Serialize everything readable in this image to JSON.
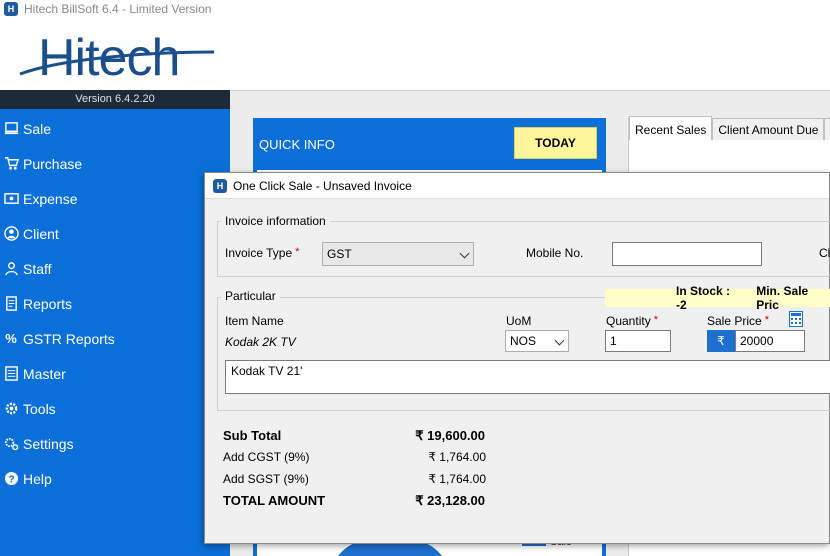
{
  "app": {
    "window_title": "Hitech BillSoft 6.4 - Limited Version",
    "logo_text": "Hitech",
    "version": "Version 6.4.2.20"
  },
  "sidebar": {
    "items": [
      {
        "label": "Sale",
        "icon": "sale-icon"
      },
      {
        "label": "Purchase",
        "icon": "cart-icon"
      },
      {
        "label": "Expense",
        "icon": "wallet-icon"
      },
      {
        "label": "Client",
        "icon": "user-icon"
      },
      {
        "label": "Staff",
        "icon": "staff-icon"
      },
      {
        "label": "Reports",
        "icon": "reports-icon"
      },
      {
        "label": "GSTR Reports",
        "icon": "percent-icon"
      },
      {
        "label": "Master",
        "icon": "list-icon"
      },
      {
        "label": "Tools",
        "icon": "gear-icon"
      },
      {
        "label": "Settings",
        "icon": "settings-icon"
      },
      {
        "label": "Help",
        "icon": "help-icon"
      }
    ]
  },
  "quick_info": {
    "title": "QUICK INFO",
    "today_label": "TODAY",
    "legend_sale": "Sale"
  },
  "right_tabs": [
    {
      "label": "Recent Sales",
      "active": true
    },
    {
      "label": "Client Amount Due",
      "active": false
    },
    {
      "label": "A",
      "active": false
    }
  ],
  "dialog": {
    "title": "One Click Sale - Unsaved Invoice",
    "invoice_info": {
      "group_label": "Invoice information",
      "invoice_type_label": "Invoice Type",
      "invoice_type_value": "GST",
      "mobile_label": "Mobile No.",
      "mobile_value": "",
      "client_label_partial": "Cl"
    },
    "particular": {
      "group_label": "Particular",
      "stock_text": "In Stock : -2",
      "min_sale_text": "Min. Sale Pric",
      "item_name_label": "Item Name",
      "item_name_value": "Kodak 2K TV",
      "uom_label": "UoM",
      "uom_value": "NOS",
      "quantity_label": "Quantity",
      "quantity_value": "1",
      "sale_price_label": "Sale Price",
      "currency_symbol": "₹",
      "sale_price_value": "20000",
      "description_value": "Kodak TV 21'"
    },
    "summary": {
      "sub_total_label": "Sub Total",
      "sub_total_value": "₹ 19,600.00",
      "cgst_label": "Add CGST (9%)",
      "cgst_value": "₹ 1,764.00",
      "sgst_label": "Add SGST (9%)",
      "sgst_value": "₹ 1,764.00",
      "total_label": "TOTAL AMOUNT",
      "total_value": "₹ 23,128.00"
    }
  },
  "colors": {
    "sidebar_blue": "#0a6fd8",
    "version_bar": "#1d2a3a",
    "today_yellow": "#fff59a",
    "stock_yellow": "#ffffc8",
    "logo_blue": "#1b4f8c",
    "required_red": "#d00000"
  }
}
